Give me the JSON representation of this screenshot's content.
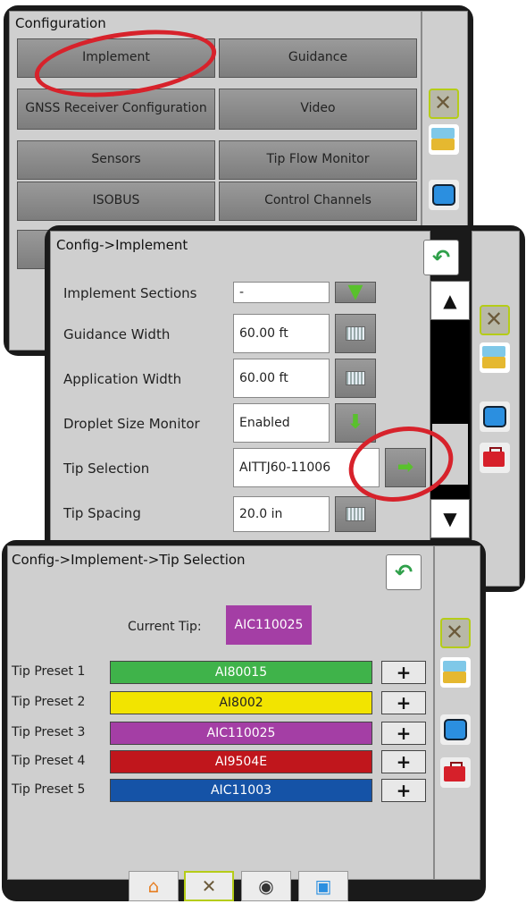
{
  "panel1": {
    "title": "Configuration",
    "buttons": [
      {
        "label": "Implement"
      },
      {
        "label": "Guidance"
      },
      {
        "label": "GNSS Receiver Configuration"
      },
      {
        "label": "Video"
      },
      {
        "label": "Sensors"
      },
      {
        "label": "Tip Flow Monitor"
      },
      {
        "label": "ISOBUS"
      },
      {
        "label": "Control Channels"
      }
    ]
  },
  "panel2": {
    "title": "Config->Implement",
    "rows": [
      {
        "label": "Implement Sections",
        "value": "-"
      },
      {
        "label": "Guidance Width",
        "value": "60.00 ft"
      },
      {
        "label": "Application Width",
        "value": "60.00 ft"
      },
      {
        "label": "Droplet Size Monitor",
        "value": "Enabled"
      },
      {
        "label": "Tip Selection",
        "value": "AITTJ60-11006"
      },
      {
        "label": "Tip Spacing",
        "value": "20.0 in"
      }
    ]
  },
  "panel3": {
    "title": "Config->Implement->Tip Selection",
    "current_tip_label": "Current Tip:",
    "current_tip_value": "AIC110025",
    "presets": [
      {
        "label": "Tip Preset 1",
        "value": "AI80015",
        "color": "#3fb34a",
        "text_color": "#ffffff"
      },
      {
        "label": "Tip Preset 2",
        "value": "AI8002",
        "color": "#f2e400",
        "text_color": "#222222"
      },
      {
        "label": "Tip Preset 3",
        "value": "AIC110025",
        "color": "#a43ea5",
        "text_color": "#ffffff"
      },
      {
        "label": "Tip Preset 4",
        "value": "AI9504E",
        "color": "#c0161c",
        "text_color": "#ffffff"
      },
      {
        "label": "Tip Preset 5",
        "value": "AIC11003",
        "color": "#1553a7",
        "text_color": "#ffffff"
      }
    ],
    "plus_label": "+"
  },
  "colors": {
    "panel_border": "#1a1a1a",
    "panel_bg": "#cfcfcf",
    "highlight_ring": "#d7222b",
    "current_tip_bg": "#a43ea5"
  },
  "icons": [
    "tools-icon",
    "tray-icon",
    "screen-icon",
    "toolbox-icon",
    "back-arrow-icon",
    "keyboard-icon",
    "down-arrow-icon",
    "right-arrow-icon",
    "home-icon",
    "camera-icon",
    "scroll-up-icon",
    "scroll-down-icon"
  ]
}
